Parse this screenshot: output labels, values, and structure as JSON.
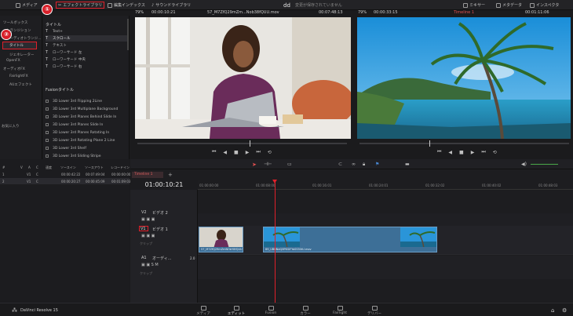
{
  "topbar": {
    "media_pool": "メディア",
    "effects_library": "エフェクトライブラリ",
    "edit_index": "編集インデックス",
    "sound_library": "サウンドライブラリ",
    "project_name": "dd",
    "status": "変更が保存されていません",
    "mixer": "ミキサー",
    "metadata": "メタデータ",
    "inspector": "インスペクタ"
  },
  "badges": {
    "one": "①",
    "two": "②"
  },
  "bin": {
    "items": [
      "ツールボックス",
      "トランジション",
      "オーディオトランジ...",
      "タイトル",
      "ジェネレーター",
      "OpenFX",
      "オーディオFX",
      "FairlightFX",
      "AUエフェクト"
    ],
    "favorites": "お気に入り"
  },
  "fx": {
    "title_heading": "タイトル",
    "items": [
      "Text+",
      "スクロール",
      "テキスト",
      "ローワーサード 左",
      "ローワーサード 中央",
      "ローワーサード 右"
    ],
    "fusion_heading": "Fusionタイトル",
    "fusion_items": [
      "3D Lower 3rd Flipping 2Line",
      "3D Lower 3rd Multiplane Background",
      "3D Lower 3rd Planes Behind Slide In",
      "3D Lower 3rd Planes Slide In",
      "3D Lower 3rd Planes Rotating In",
      "3D Lower 3rd Rotating Plane 2 Line",
      "3D Lower 3rd Shelf",
      "3D Lower 3rd Sliding Stripe"
    ]
  },
  "source_viewer": {
    "zoom": "79%",
    "timecode": "00:00:10:21",
    "clip_name": "57_M7ZfQ29mZm...Nob38fQUU.mov",
    "timecode_right": "00:07:48:13"
  },
  "timeline_viewer": {
    "zoom": "79%",
    "duration": "00:00:33:15",
    "timeline_name": "Timeline 1",
    "timecode": "00:01:11:06"
  },
  "pool": {
    "headers": [
      "#",
      "V",
      "A",
      "C",
      "速度",
      "ソースイン",
      "ソースアウト",
      "レコードイン"
    ],
    "rows": [
      [
        "1",
        "V1",
        "C",
        "",
        "",
        "00:00:42:22",
        "00:07:49:04",
        "00:00:00:00"
      ],
      [
        "2",
        "V1",
        "C",
        "",
        "",
        "00:00:20:27",
        "00:00:45:09",
        "00:01:09:03"
      ]
    ]
  },
  "timeline": {
    "tab_name": "Timeline 1",
    "current_timecode": "01:00:10:21",
    "ruler": [
      "01:00:00:00",
      "01:00:08:00",
      "01:00:16:01",
      "01:00:24:01",
      "01:00:32:02",
      "01:00:40:02",
      "01:00:48:03"
    ],
    "tracks": {
      "v2_label": "V2",
      "v2_name": "ビデオ 2",
      "v1_label": "V1",
      "v1_name": "ビデオ 1",
      "a1_label": "A1",
      "a1_name": "オーディ...",
      "a1_ch": "2.0",
      "clips_label": "クリップ"
    },
    "clip1_name": "57_M7ZfQ29mZmNObY8fQUU.mov",
    "clip2_name": "69_UBHNaQ8PKSIFYaSS50tU.mov"
  },
  "app_name": "DaVinci Resolve 15",
  "pages": [
    "メディア",
    "エディット",
    "Fusion",
    "カラー",
    "Fairlight",
    "デリバー"
  ],
  "colors": {
    "accent_red": "#e0202a",
    "clip_blue": "#3d6f97"
  }
}
